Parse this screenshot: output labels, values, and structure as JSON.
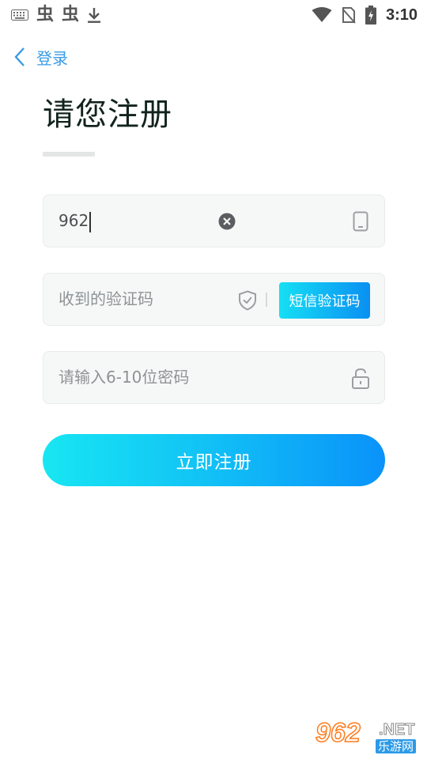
{
  "status_bar": {
    "time": "3:10",
    "left_icons": [
      "keyboard-icon",
      "app-notification-icon",
      "app-notification-icon",
      "download-icon"
    ],
    "app_glyph": "虫",
    "right_icons": [
      "wifi-icon",
      "no-sim-icon",
      "battery-charging-icon"
    ]
  },
  "header": {
    "back_label": "登录",
    "title": "请您注册"
  },
  "form": {
    "phone": {
      "value": "962",
      "icons": [
        "clear-icon",
        "phone-icon"
      ]
    },
    "code": {
      "placeholder": "收到的验证码",
      "button_label": "短信验证码",
      "icons": [
        "shield-check-icon"
      ]
    },
    "password": {
      "placeholder": "请输入6-10位密码",
      "icons": [
        "lock-icon"
      ]
    },
    "submit_label": "立即注册"
  },
  "watermark": {
    "number": "962",
    "suffix": ".NET",
    "cn_text": "乐游网"
  },
  "colors": {
    "accent_blue": "#3a9be5",
    "gradient_start": "#18e6f2",
    "gradient_end": "#0a92fa",
    "title": "#12231d"
  }
}
